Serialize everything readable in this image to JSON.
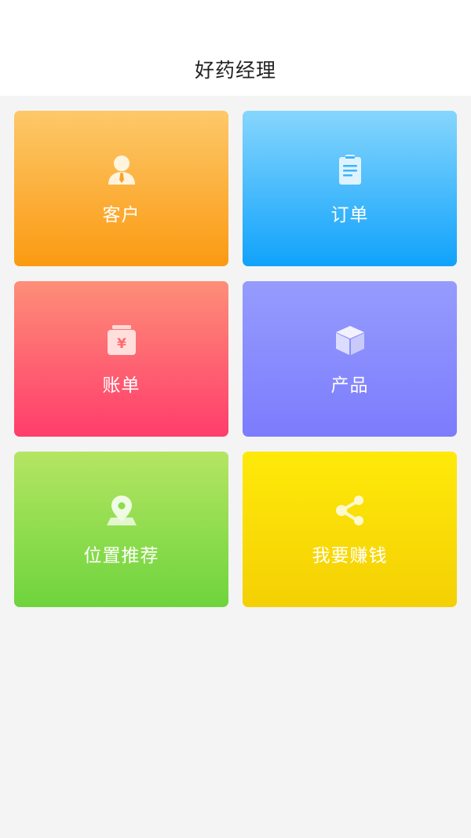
{
  "header": {
    "title": "好药经理"
  },
  "tiles": [
    {
      "label": "客户",
      "icon": "customer-icon",
      "color_top": "#fdc86a",
      "color_bottom": "#fb9a12"
    },
    {
      "label": "订单",
      "icon": "clipboard-icon",
      "color_top": "#86d6fd",
      "color_bottom": "#10a2fb"
    },
    {
      "label": "账单",
      "icon": "yuan-bill-icon",
      "color_top": "#fe8e78",
      "color_bottom": "#ff3d6c"
    },
    {
      "label": "产品",
      "icon": "box-icon",
      "color_top": "#959cfd",
      "color_bottom": "#7c7cfd"
    },
    {
      "label": "位置推荐",
      "icon": "location-pin-icon",
      "color_top": "#b4e563",
      "color_bottom": "#6ed43c"
    },
    {
      "label": "我要赚钱",
      "icon": "share-icon",
      "color_top": "#ffe90a",
      "color_bottom": "#f4d004"
    }
  ]
}
